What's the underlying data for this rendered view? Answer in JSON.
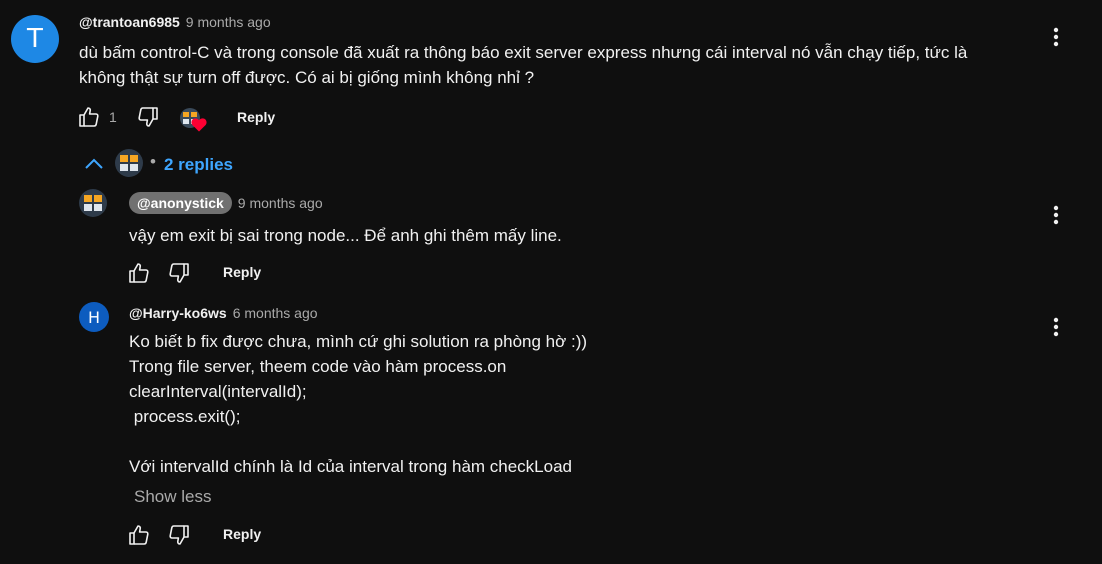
{
  "comment": {
    "avatar_letter": "T",
    "avatar_color": "#1e88e5",
    "author": "@trantoan6985",
    "time": "9 months ago",
    "text": "dù bấm control-C và trong console đã xuất ra thông báo exit server express nhưng cái interval nó vẫn chạy tiếp, tức là\nkhông thật sự turn off được. Có ai bị giống mình không nhỉ ?",
    "like_count": "1",
    "reply_label": "Reply",
    "replies_label": "2 replies"
  },
  "replies": [
    {
      "author": "@anonystick",
      "time": "9 months ago",
      "text": "vậy em exit bị sai trong node... Để anh ghi thêm mấy line.",
      "reply_label": "Reply"
    },
    {
      "avatar_letter": "H",
      "avatar_color": "#0d5cbf",
      "author": "@Harry-ko6ws",
      "time": "6 months ago",
      "text": "Ko biết b fix được chưa, mình cứ ghi solution ra phòng hờ :))\nTrong file server, theem code vào hàm process.on\nclearInterval(intervalId);\n process.exit();\n\nVới intervalId chính là Id của interval trong hàm checkLoad",
      "show_less_label": "Show less",
      "reply_label": "Reply"
    }
  ],
  "colors": {
    "background": "#0f0f0f",
    "link_blue": "#3ea6ff",
    "heart_red": "#ff0033",
    "chip_gray": "#717171"
  },
  "icons": [
    "like-icon",
    "dislike-icon",
    "heart-icon",
    "more-vert-icon",
    "chevron-up-icon"
  ]
}
